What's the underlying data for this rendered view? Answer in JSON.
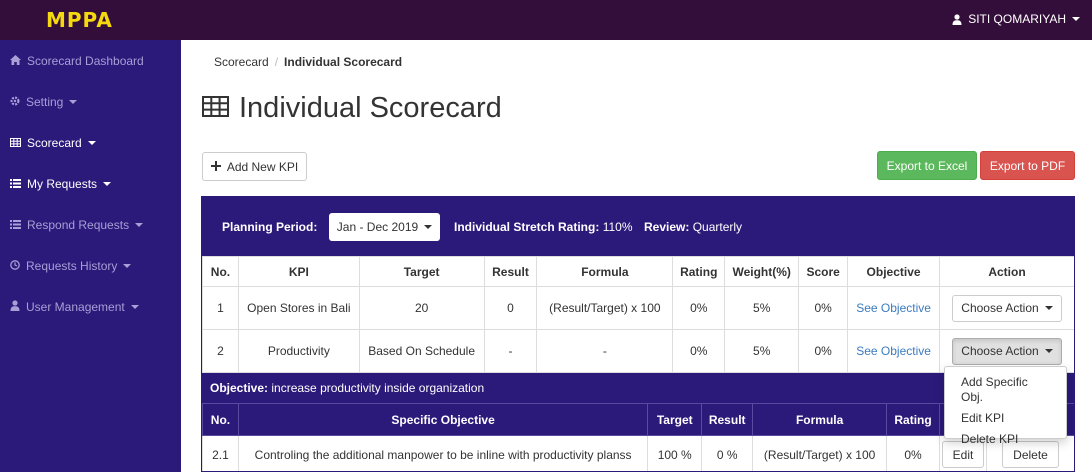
{
  "app": {
    "brand": "MPPA",
    "user_name": "SITI QOMARIYAH"
  },
  "sidebar": {
    "items": [
      {
        "label": "Scorecard Dashboard",
        "icon": "home-icon",
        "caret": false,
        "active": false
      },
      {
        "label": "Setting",
        "icon": "gear-icon",
        "caret": true,
        "active": false
      },
      {
        "label": "Scorecard",
        "icon": "table-icon",
        "caret": true,
        "active": true
      },
      {
        "label": "My Requests",
        "icon": "list-icon",
        "caret": true,
        "active": true
      },
      {
        "label": "Respond Requests",
        "icon": "list-icon",
        "caret": true,
        "active": false
      },
      {
        "label": "Requests History",
        "icon": "clock-icon",
        "caret": true,
        "active": false
      },
      {
        "label": "User Management",
        "icon": "user-icon",
        "caret": true,
        "active": false
      }
    ]
  },
  "breadcrumb": {
    "parent": "Scorecard",
    "sep": "/",
    "current": "Individual Scorecard"
  },
  "page": {
    "title": "Individual Scorecard"
  },
  "toolbar": {
    "add_kpi": "Add New KPI",
    "export_excel": "Export to Excel",
    "export_pdf": "Export to PDF"
  },
  "panel": {
    "planning_label": "Planning Period:",
    "period_value": "Jan - Dec 2019",
    "stretch_label": "Individual Stretch Rating:",
    "stretch_value": "110%",
    "review_label": "Review:",
    "review_value": "Quarterly"
  },
  "kpi_table": {
    "headers": [
      "No.",
      "KPI",
      "Target",
      "Result",
      "Formula",
      "Rating",
      "Weight(%)",
      "Score",
      "Objective",
      "Action"
    ],
    "rows": [
      {
        "no": "1",
        "kpi": "Open Stores in Bali",
        "target": "20",
        "result": "0",
        "formula": "(Result/Target) x 100",
        "rating": "0%",
        "weight": "5%",
        "score": "0%",
        "objective": "See Objective",
        "action": "Choose Action"
      },
      {
        "no": "2",
        "kpi": "Productivity",
        "target": "Based On Schedule",
        "result": "-",
        "formula": "-",
        "rating": "0%",
        "weight": "5%",
        "score": "0%",
        "objective": "See Objective",
        "action": "Choose Action"
      }
    ]
  },
  "objective": {
    "label": "Objective:",
    "text": "increase productivity inside organization"
  },
  "sub_table": {
    "headers": [
      "No.",
      "Specific Objective",
      "Target",
      "Result",
      "Formula",
      "Rating"
    ],
    "rows": [
      {
        "no": "2.1",
        "objective": "Controling the additional manpower to be inline with productivity planss",
        "target": "100 %",
        "result": "0 %",
        "formula": "(Result/Target) x 100",
        "rating": "0%",
        "edit": "Edit",
        "delete": "Delete"
      }
    ]
  },
  "dropdown": {
    "items": [
      "Add Specific Obj.",
      "Edit KPI",
      "Delete KPI"
    ]
  }
}
